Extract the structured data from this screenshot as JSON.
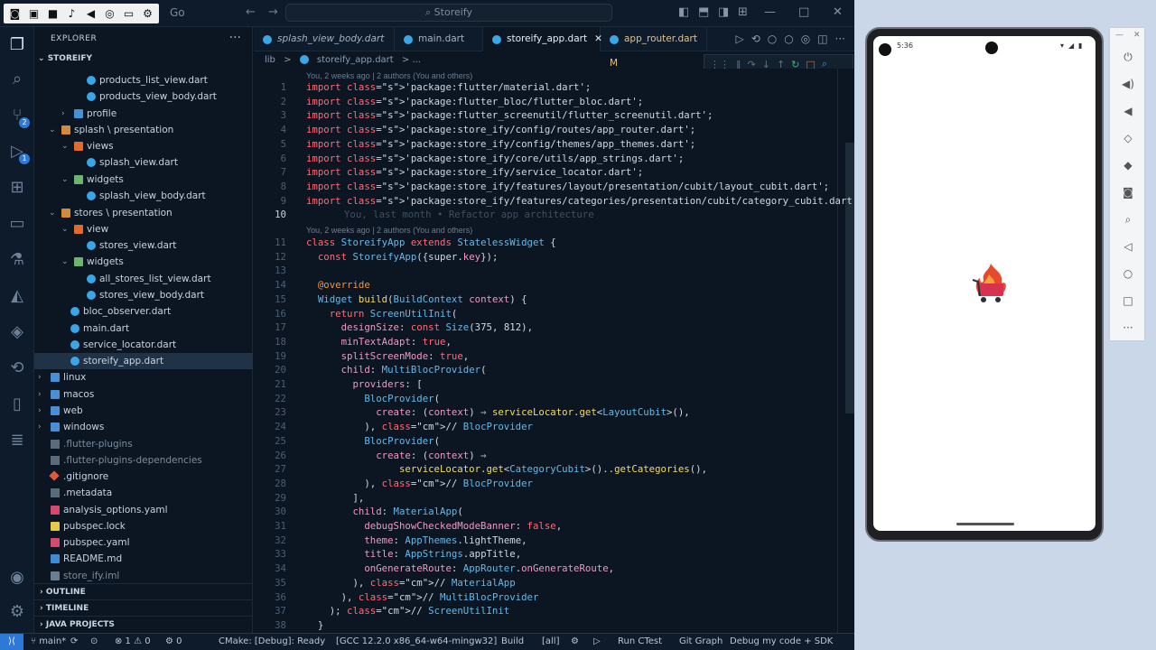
{
  "titlebar": {
    "go_label": "Go",
    "search_text": "Storeify"
  },
  "sidebar": {
    "header": "EXPLORER",
    "project": "STOREIFY",
    "items": [
      {
        "label": "products_list_view.dart",
        "icon": "dart-file-icon"
      },
      {
        "label": "products_view_body.dart",
        "icon": "dart-file-icon"
      },
      {
        "label": "profile",
        "icon": "folder-icon"
      },
      {
        "label": "splash \\ presentation",
        "icon": "folder-icon"
      },
      {
        "label": "views",
        "icon": "folder-icon"
      },
      {
        "label": "splash_view.dart",
        "icon": "dart-file-icon"
      },
      {
        "label": "widgets",
        "icon": "folder-icon"
      },
      {
        "label": "splash_view_body.dart",
        "icon": "dart-file-icon"
      },
      {
        "label": "stores \\ presentation",
        "icon": "folder-icon"
      },
      {
        "label": "view",
        "icon": "folder-icon"
      },
      {
        "label": "stores_view.dart",
        "icon": "dart-file-icon"
      },
      {
        "label": "widgets",
        "icon": "folder-icon"
      },
      {
        "label": "all_stores_list_view.dart",
        "icon": "dart-file-icon"
      },
      {
        "label": "stores_view_body.dart",
        "icon": "dart-file-icon"
      },
      {
        "label": "bloc_observer.dart",
        "icon": "dart-file-icon"
      },
      {
        "label": "main.dart",
        "icon": "dart-file-icon"
      },
      {
        "label": "service_locator.dart",
        "icon": "dart-file-icon"
      },
      {
        "label": "storeify_app.dart",
        "icon": "dart-file-icon"
      },
      {
        "label": "linux",
        "icon": "folder-icon"
      },
      {
        "label": "macos",
        "icon": "folder-icon"
      },
      {
        "label": "web",
        "icon": "folder-icon"
      },
      {
        "label": "windows",
        "icon": "folder-icon"
      },
      {
        "label": ".flutter-plugins",
        "icon": "file-icon"
      },
      {
        "label": ".flutter-plugins-dependencies",
        "icon": "file-icon"
      },
      {
        "label": ".gitignore",
        "icon": "git-icon"
      },
      {
        "label": ".metadata",
        "icon": "file-icon"
      },
      {
        "label": "analysis_options.yaml",
        "icon": "yaml-icon"
      },
      {
        "label": "pubspec.lock",
        "icon": "lock-icon"
      },
      {
        "label": "pubspec.yaml",
        "icon": "yaml-icon"
      },
      {
        "label": "README.md",
        "icon": "readme-icon"
      },
      {
        "label": "store_ify.iml",
        "icon": "file-icon"
      }
    ],
    "outline": "OUTLINE",
    "timeline": "TIMELINE",
    "java_projects": "JAVA PROJECTS"
  },
  "tabs": [
    {
      "label": "splash_view_body.dart"
    },
    {
      "label": "main.dart"
    },
    {
      "label": "storeify_app.dart"
    },
    {
      "label": "app_router.dart",
      "status": "M"
    }
  ],
  "breadcrumb": {
    "root": "lib",
    "sep": ">",
    "file": "storeify_app.dart",
    "tail": "> ..."
  },
  "editor": {
    "lens1": "You, 2 weeks ago | 2 authors (You and others)",
    "lens2": "You, 2 weeks ago | 2 authors (You and others)",
    "blame": "You, last month • Refactor app architecture",
    "lines": [
      {
        "n": "1",
        "text": "import 'package:flutter/material.dart';"
      },
      {
        "n": "2",
        "text": "import 'package:flutter_bloc/flutter_bloc.dart';"
      },
      {
        "n": "3",
        "text": "import 'package:flutter_screenutil/flutter_screenutil.dart';"
      },
      {
        "n": "4",
        "text": "import 'package:store_ify/config/routes/app_router.dart';"
      },
      {
        "n": "5",
        "text": "import 'package:store_ify/config/themes/app_themes.dart';"
      },
      {
        "n": "6",
        "text": "import 'package:store_ify/core/utils/app_strings.dart';"
      },
      {
        "n": "7",
        "text": "import 'package:store_ify/service_locator.dart';"
      },
      {
        "n": "8",
        "text": "import 'package:store_ify/features/layout/presentation/cubit/layout_cubit.dart';"
      },
      {
        "n": "9",
        "text": "import 'package:store_ify/features/categories/presentation/cubit/category_cubit.dart';"
      },
      {
        "n": "10",
        "text": ""
      },
      {
        "n": "11",
        "text": "class StoreifyApp extends StatelessWidget {"
      },
      {
        "n": "12",
        "text": "  const StoreifyApp({super.key});"
      },
      {
        "n": "13",
        "text": ""
      },
      {
        "n": "14",
        "text": "  @override"
      },
      {
        "n": "15",
        "text": "  Widget build(BuildContext context) {"
      },
      {
        "n": "16",
        "text": "    return ScreenUtilInit("
      },
      {
        "n": "17",
        "text": "      designSize: const Size(375, 812),"
      },
      {
        "n": "18",
        "text": "      minTextAdapt: true,"
      },
      {
        "n": "19",
        "text": "      splitScreenMode: true,"
      },
      {
        "n": "20",
        "text": "      child: MultiBlocProvider("
      },
      {
        "n": "21",
        "text": "        providers: ["
      },
      {
        "n": "22",
        "text": "          BlocProvider("
      },
      {
        "n": "23",
        "text": "            create: (context) ⇒ serviceLocator.get<LayoutCubit>(),"
      },
      {
        "n": "24",
        "text": "          ), // BlocProvider"
      },
      {
        "n": "25",
        "text": "          BlocProvider("
      },
      {
        "n": "26",
        "text": "            create: (context) ⇒"
      },
      {
        "n": "27",
        "text": "                serviceLocator.get<CategoryCubit>()..getCategories(),"
      },
      {
        "n": "28",
        "text": "          ), // BlocProvider"
      },
      {
        "n": "29",
        "text": "        ],"
      },
      {
        "n": "30",
        "text": "        child: MaterialApp("
      },
      {
        "n": "31",
        "text": "          debugShowCheckedModeBanner: false,"
      },
      {
        "n": "32",
        "text": "          theme: AppThemes.lightTheme,"
      },
      {
        "n": "33",
        "text": "          title: AppStrings.appTitle,"
      },
      {
        "n": "34",
        "text": "          onGenerateRoute: AppRouter.onGenerateRoute,"
      },
      {
        "n": "35",
        "text": "        ), // MaterialApp"
      },
      {
        "n": "36",
        "text": "      ), // MultiBlocProvider"
      },
      {
        "n": "37",
        "text": "    ); // ScreenUtilInit"
      },
      {
        "n": "38",
        "text": "  }"
      }
    ]
  },
  "statusbar": {
    "branch": "main*",
    "errors": "⊗ 1 ⚠ 0",
    "ports": "⚙ 0",
    "cmake": "CMake: [Debug]: Ready",
    "kit": "[GCC 12.2.0 x86_64-w64-mingw32]",
    "build": "Build",
    "all": "[all]",
    "run_ctest": "Run CTest",
    "git_graph": "Git Graph",
    "debug": "Debug my code + SDK"
  },
  "emulator": {
    "time": "5:36",
    "app_icon": "storeify-cart-flame-logo"
  },
  "colors": {
    "accent": "#2e78d6",
    "editor_bg": "#0b1622"
  }
}
